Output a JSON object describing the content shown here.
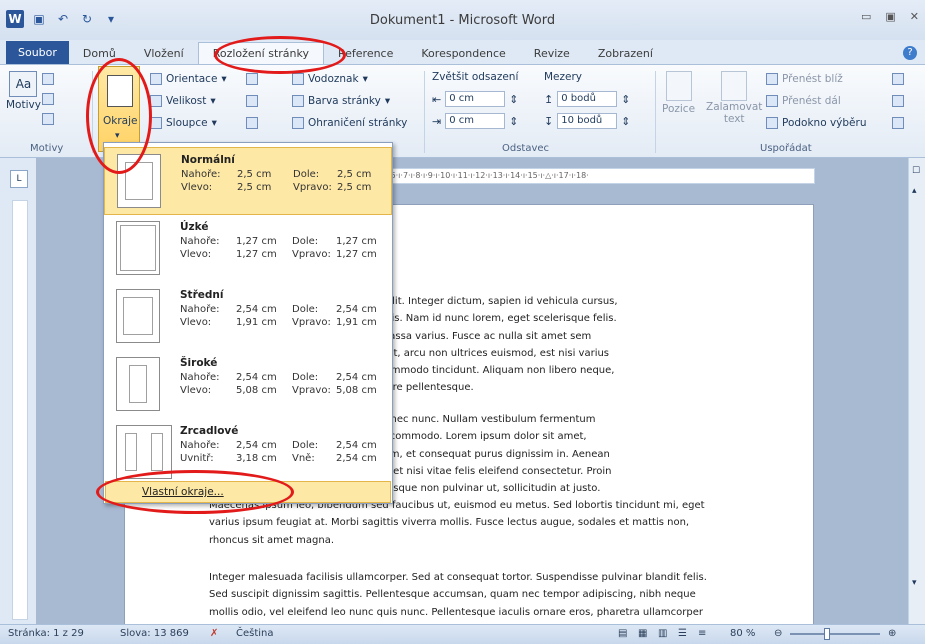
{
  "window": {
    "title": "Dokument1 - Microsoft Word"
  },
  "tabs": [
    "Soubor",
    "Domů",
    "Vložení",
    "Rozložení stránky",
    "Reference",
    "Korespondence",
    "Revize",
    "Zobrazení"
  ],
  "ribbon": {
    "motivy": {
      "big_label": "Motivy",
      "group_label": "Motivy"
    },
    "okraje": {
      "label": "Okraje"
    },
    "page_setup": {
      "orientace": "Orientace",
      "velikost": "Velikost",
      "sloupce": "Sloupce",
      "vodoznak": "Vodoznak",
      "barva_stranky": "Barva stránky",
      "ohraniceni": "Ohraničení stránky"
    },
    "odstavec": {
      "group_label": "Odstavec",
      "zvetsit_odsazeni": "Zvětšit odsazení",
      "mezery": "Mezery",
      "indent_left": "0 cm",
      "indent_right": "0 cm",
      "space_before": "0 bodů",
      "space_after": "10 bodů"
    },
    "usporadat": {
      "group_label": "Uspořádat",
      "pozice": "Pozice",
      "zalamovat": "Zalamovat",
      "zalamovat2": "text",
      "prenest_bliz": "Přenést blíž",
      "prenest_dal": "Přenést dál",
      "podokno": "Podokno výběru"
    }
  },
  "margins_menu": {
    "items": [
      {
        "name": "Normální",
        "top_label": "Nahoře:",
        "top": "2,5 cm",
        "bottom_label": "Dole:",
        "bottom": "2,5 cm",
        "left_label": "Vlevo:",
        "left": "2,5 cm",
        "right_label": "Vpravo:",
        "right": "2,5 cm"
      },
      {
        "name": "Úzké",
        "top_label": "Nahoře:",
        "top": "1,27 cm",
        "bottom_label": "Dole:",
        "bottom": "1,27 cm",
        "left_label": "Vlevo:",
        "left": "1,27 cm",
        "right_label": "Vpravo:",
        "right": "1,27 cm"
      },
      {
        "name": "Střední",
        "top_label": "Nahoře:",
        "top": "2,54 cm",
        "bottom_label": "Dole:",
        "bottom": "2,54 cm",
        "left_label": "Vlevo:",
        "left": "1,91 cm",
        "right_label": "Vpravo:",
        "right": "1,91 cm"
      },
      {
        "name": "Široké",
        "top_label": "Nahoře:",
        "top": "2,54 cm",
        "bottom_label": "Dole:",
        "bottom": "2,54 cm",
        "left_label": "Vlevo:",
        "left": "5,08 cm",
        "right_label": "Vpravo:",
        "right": "5,08 cm"
      },
      {
        "name": "Zrcadlové",
        "top_label": "Nahoře:",
        "top": "2,54 cm",
        "bottom_label": "Dole:",
        "bottom": "2,54 cm",
        "left_label": "Uvnitř:",
        "left": "3,18 cm",
        "right_label": "Vně:",
        "right": "2,54 cm"
      }
    ],
    "custom": "Vlastní okraje..."
  },
  "ruler": {
    "marks": "·6·ı·7·ı·8·ı·9·ı·10·ı·11·ı·12·ı·13·ı·14·ı·15·ı·△·ı·17·ı·18·"
  },
  "document": {
    "p1_lines": [
      "ectetur adipiscing elit. Integer dictum, sapien id vehicula cursus,",
      "s mauris dui at turpis. Nam id nunc lorem, eget scelerisque felis.",
      "scipit non mattis massa varius. Fusce ac nulla sit amet sem",
      "bh. Curabitur laoreet, arcu non ultrices euismod, est nisi varius",
      "igula. In rhoncus commodo tincidunt. Aliquam non libero neque,",
      "isus vitae dui posuere pellentesque."
    ],
    "p2_lines": [
      "ndit a, consectetur nec nunc. Nullam vestibulum fermentum",
      "ollis massa feugiat commodo. Lorem ipsum dolor sit amet,",
      "endum eleifend diam, et consequat purus dignissim in. Aenean",
      "les. Pellentesque eget nisi vitae felis eleifend consectetur. Proin",
      "d felis libero, scelerisque non pulvinar ut, sollicitudin at justo.",
      "Maecenas ipsum leo, bibendum sed faucibus ut, euismod eu metus. Sed lobortis tincidunt mi, eget",
      "varius ipsum feugiat at. Morbi sagittis viverra mollis. Fusce lectus augue, sodales et mattis non,",
      "rhoncus sit amet magna."
    ],
    "p3_lines": [
      "Integer malesuada facilisis ullamcorper. Sed at consequat tortor. Suspendisse pulvinar blandit felis.",
      "Sed suscipit dignissim sagittis. Pellentesque accumsan, quam nec tempor adipiscing, nibh neque",
      "mollis odio, vel eleifend leo nunc quis nunc. Pellentesque iaculis ornare eros, pharetra ullamcorper"
    ]
  },
  "status": {
    "page": "Stránka: 1 z 29",
    "words": "Slova: 13 869",
    "language": "Čeština",
    "zoom": "80 %"
  },
  "colors": {
    "accent": "#2b579a",
    "highlight": "#fde8a6",
    "annotation": "#e21a1a"
  }
}
